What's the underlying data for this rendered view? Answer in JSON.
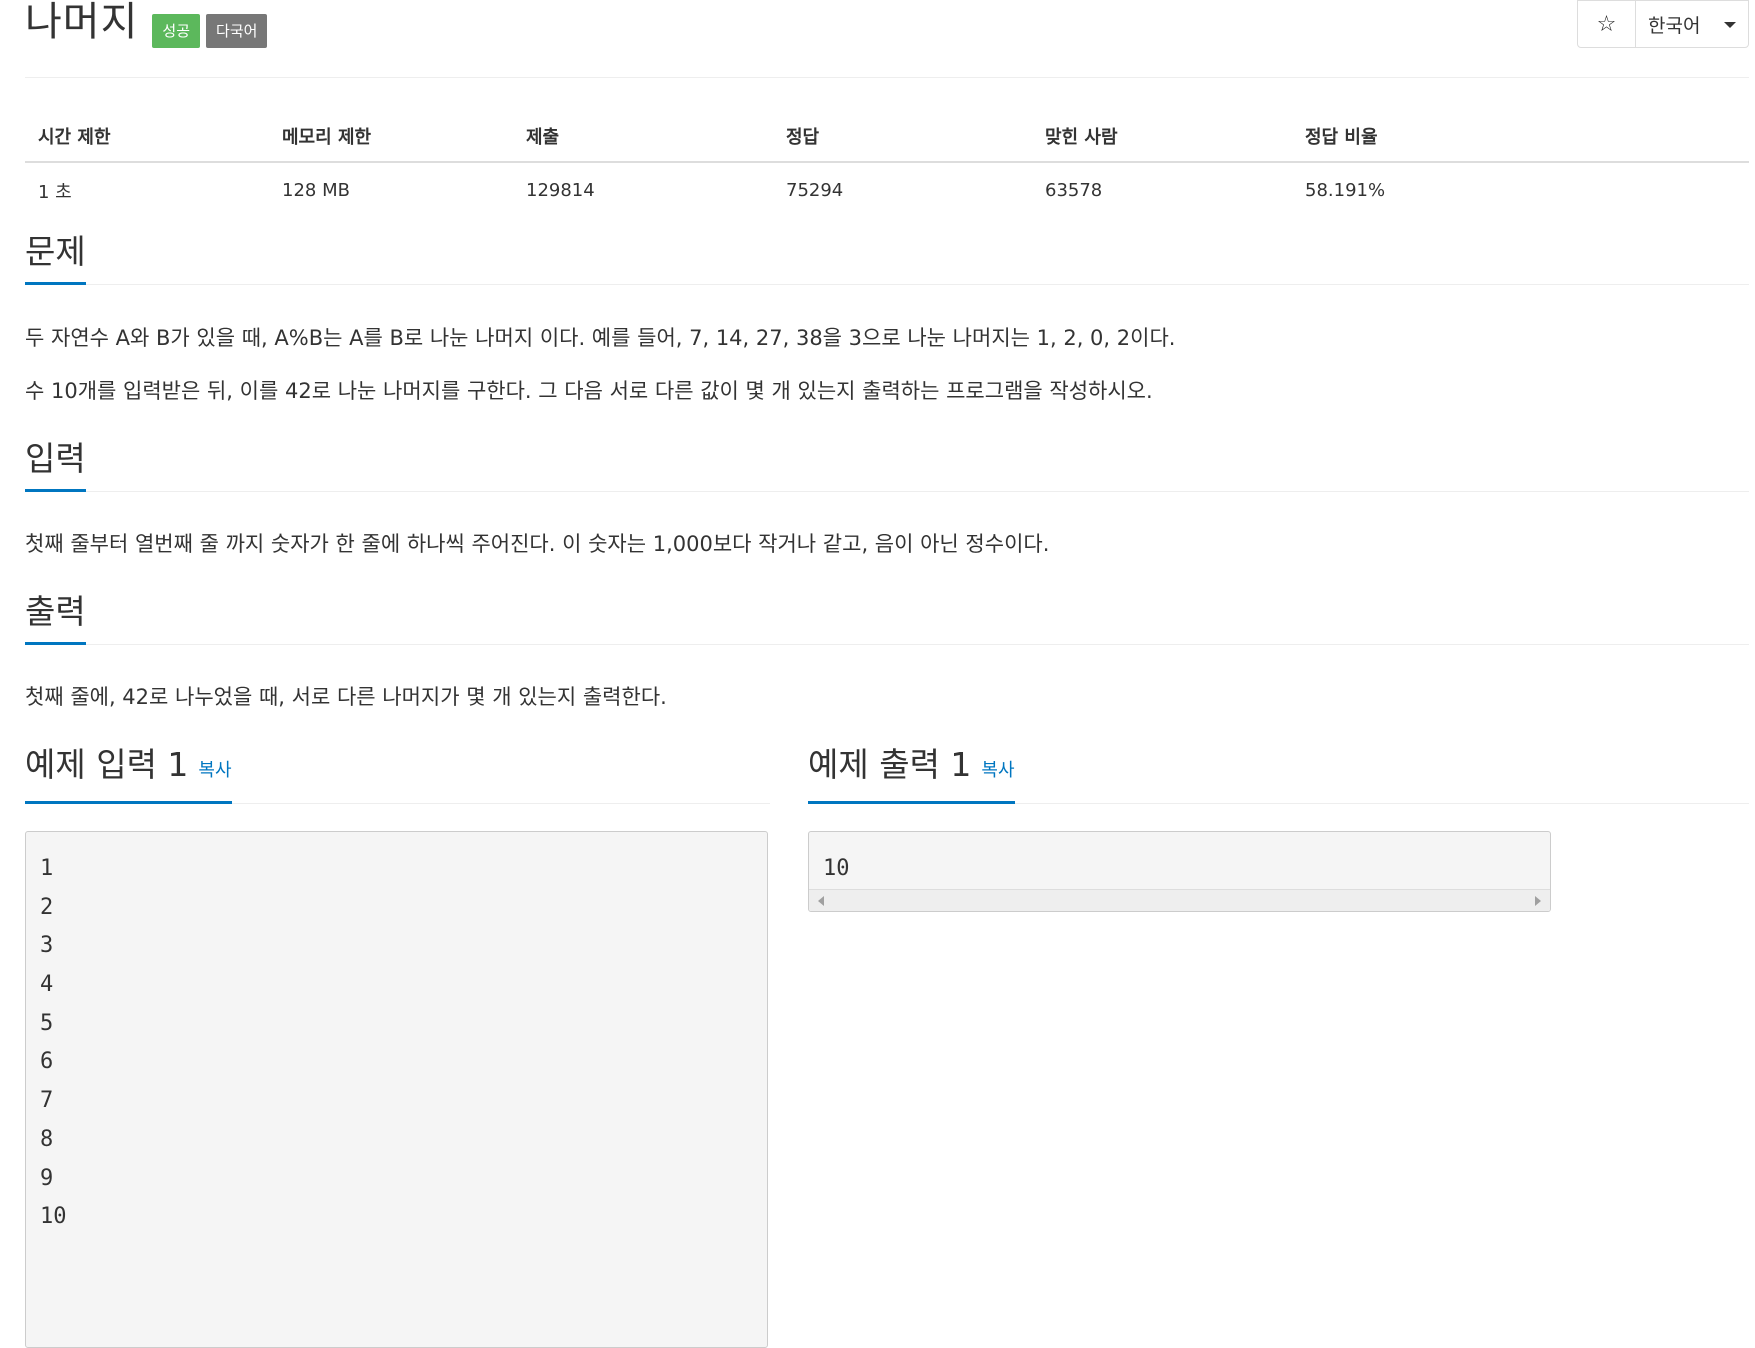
{
  "problem": {
    "title": "나머지",
    "badges": {
      "status": "성공",
      "language": "다국어"
    }
  },
  "toolbar": {
    "star_icon": "☆",
    "language_selected": "한국어"
  },
  "info_table": {
    "headers": [
      "시간 제한",
      "메모리 제한",
      "제출",
      "정답",
      "맞힌 사람",
      "정답 비율"
    ],
    "values": [
      "1 초",
      "128 MB",
      "129814",
      "75294",
      "63578",
      "58.191%"
    ]
  },
  "sections": {
    "problem": {
      "heading": "문제",
      "paragraphs": [
        "두 자연수 A와 B가 있을 때, A%B는 A를 B로 나눈 나머지 이다. 예를 들어, 7, 14, 27, 38을 3으로 나눈 나머지는 1, 2, 0, 2이다.",
        "수 10개를 입력받은 뒤, 이를 42로 나눈 나머지를 구한다. 그 다음 서로 다른 값이 몇 개 있는지 출력하는 프로그램을 작성하시오."
      ]
    },
    "input": {
      "heading": "입력",
      "text": "첫째 줄부터 열번째 줄 까지 숫자가 한 줄에 하나씩 주어진다. 이 숫자는 1,000보다 작거나 같고, 음이 아닌 정수이다."
    },
    "output": {
      "heading": "출력",
      "text": "첫째 줄에, 42로 나누었을 때, 서로 다른 나머지가 몇 개 있는지 출력한다."
    }
  },
  "sample_input": {
    "heading": "예제 입력 1",
    "copy_label": "복사",
    "lines": [
      "1",
      "2",
      "3",
      "4",
      "5",
      "6",
      "7",
      "8",
      "9",
      "10"
    ]
  },
  "sample_output": {
    "heading": "예제 출력 1",
    "copy_label": "복사",
    "lines": [
      "10"
    ]
  },
  "colors": {
    "accent": "#0076c0",
    "success_badge": "#5cb85c",
    "language_badge": "#777777",
    "pre_background": "#f5f5f5"
  }
}
